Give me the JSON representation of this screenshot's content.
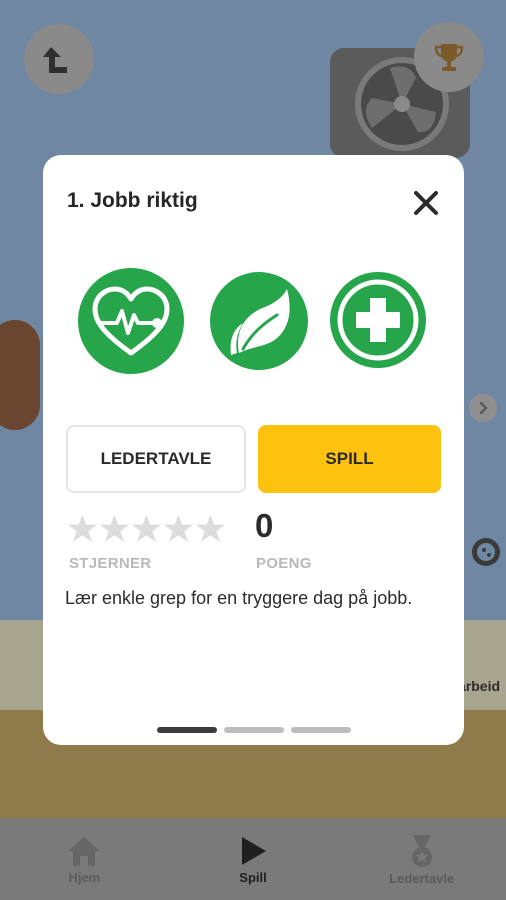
{
  "modal": {
    "title": "1. Jobb riktig",
    "icons": [
      "heart-pulse-icon",
      "leaf-icon",
      "medical-cross-icon"
    ],
    "leaderboard_button": "LEDERTAVLE",
    "play_button": "SPILL",
    "stars_label": "STJERNER",
    "stars_rating": 0,
    "stars_total": 5,
    "score_value": "0",
    "score_label": "POENG",
    "description": "Lær enkle grep for en tryggere dag på jobb.",
    "page_count": 3,
    "active_page": 1
  },
  "background": {
    "card_text": "arbeid"
  },
  "bottom_nav": {
    "items": [
      {
        "label": "Hjem",
        "icon": "home-icon"
      },
      {
        "label": "Spill",
        "icon": "play-icon",
        "active": true
      },
      {
        "label": "Ledertavle",
        "icon": "medal-icon"
      }
    ]
  },
  "colors": {
    "accent_green": "#27a54b",
    "play_yellow": "#ffc20e",
    "overlay_blue": "#6f87a3"
  }
}
